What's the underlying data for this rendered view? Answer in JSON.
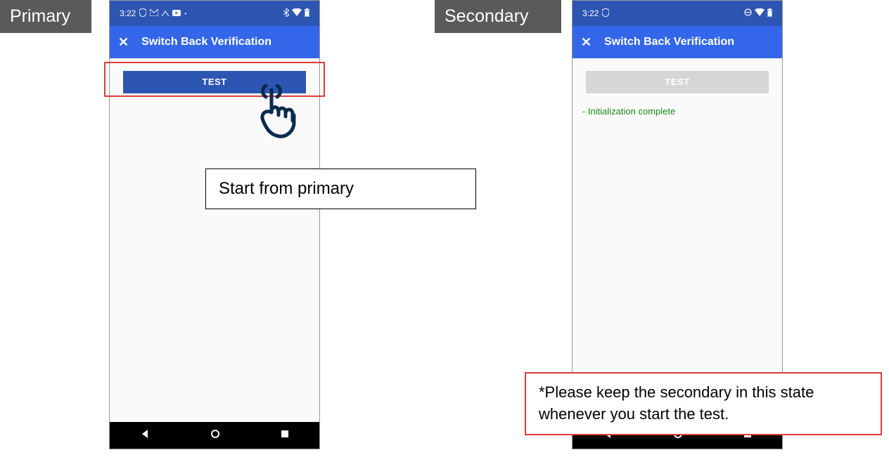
{
  "labels": {
    "primary": "Primary",
    "secondary": "Secondary"
  },
  "primary": {
    "status": {
      "time": "3:22",
      "right": "✱ ▾ ▮"
    },
    "app_title": "Switch Back Verification",
    "button": "TEST"
  },
  "secondary": {
    "status": {
      "time": "3:22",
      "right": "⊝ ▾ ▮"
    },
    "app_title": "Switch Back Verification",
    "button": "TEST",
    "message": "- Initialization complete"
  },
  "callouts": {
    "start": "Start from primary",
    "keep": "*Please keep the secondary in this state whenever you start the test."
  }
}
